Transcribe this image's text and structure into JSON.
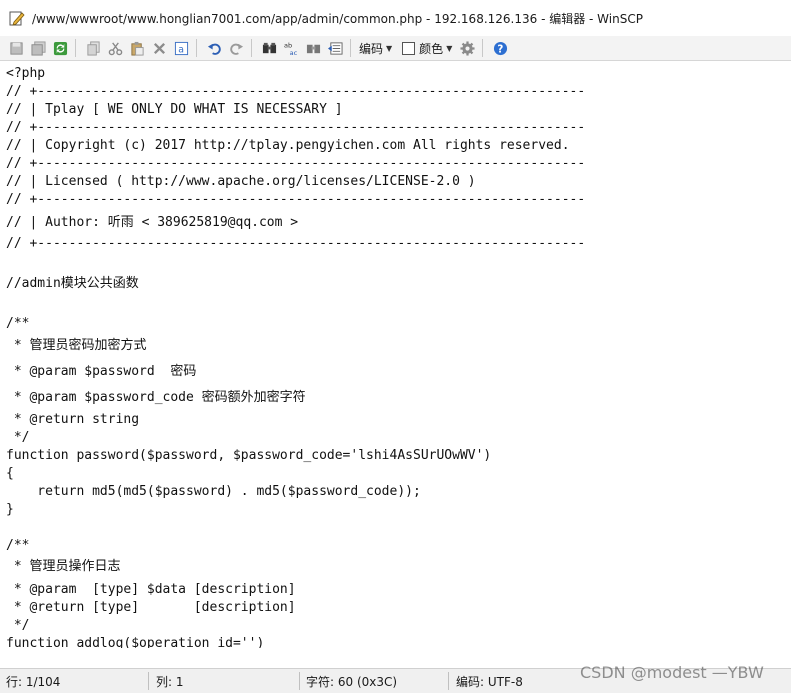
{
  "window": {
    "title": "/www/wwwroot/www.honglian7001.com/app/admin/common.php - 192.168.126.136 - 编辑器 - WinSCP"
  },
  "toolbar": {
    "encoding_label": "编码",
    "color_label": "颜色",
    "buttons": [
      "save-icon",
      "save-all-icon",
      "refresh-icon",
      "copy-icon",
      "cut-icon",
      "paste-icon",
      "delete-icon",
      "select-all-icon",
      "undo-icon",
      "redo-icon",
      "find-icon",
      "replace-icon",
      "find-next-icon",
      "goto-line-icon",
      "settings-icon",
      "help-icon"
    ]
  },
  "editor": {
    "lines": [
      "<?php",
      "// +----------------------------------------------------------------------",
      "// | Tplay [ WE ONLY DO WHAT IS NECESSARY ]",
      "// +----------------------------------------------------------------------",
      "// | Copyright (c) 2017 http://tplay.pengyichen.com All rights reserved.",
      "// +----------------------------------------------------------------------",
      "// | Licensed ( http://www.apache.org/licenses/LICENSE-2.0 )",
      "// +----------------------------------------------------------------------",
      "// | Author: 听雨 < 389625819@qq.com >",
      "// +----------------------------------------------------------------------",
      "",
      "//admin模块公共函数",
      "",
      "/**",
      " * 管理员密码加密方式",
      " * @param $password  密码",
      " * @param $password_code 密码额外加密字符",
      " * @return string",
      " */",
      "function password($password, $password_code='lshi4AsSUrUOwWV')",
      "{",
      "    return md5(md5($password) . md5($password_code));",
      "}",
      "",
      "/**",
      " * 管理员操作日志",
      " * @param  [type] $data [description]",
      " * @return [type]       [description]",
      " */",
      "function addlog($operation_id='')"
    ]
  },
  "status": {
    "line": "行: 1/104",
    "col": "列: 1",
    "char": "字符: 60 (0x3C)",
    "encoding": "编码: UTF-8"
  },
  "watermark": "CSDN @modest —YBW"
}
